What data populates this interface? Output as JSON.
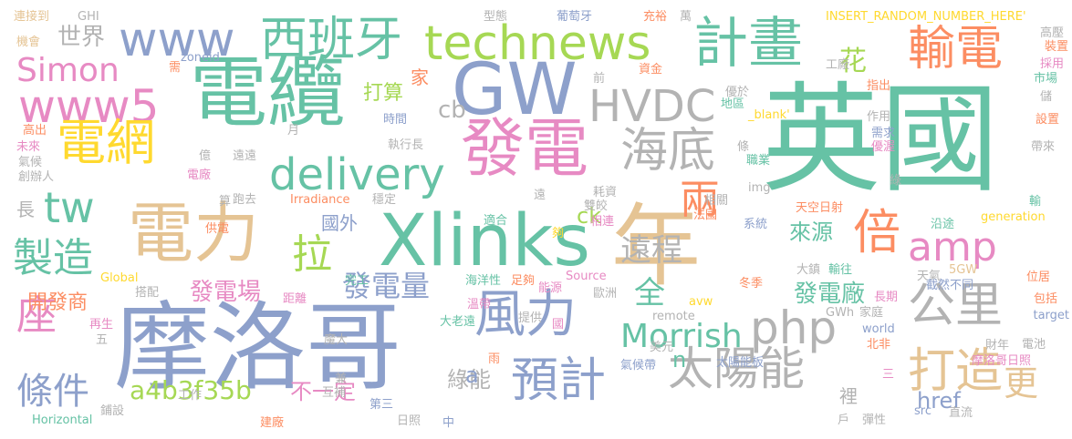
{
  "palette": {
    "green": "#66c2a5",
    "orange": "#fc8d62",
    "blue": "#8da0cb",
    "pink": "#e78ac3",
    "lime": "#a6d854",
    "yellow": "#ffd92f",
    "tan": "#e5c494",
    "gray": "#b3b3b3"
  },
  "words": [
    {
      "text": "英國",
      "color": "#66c2a5"
    },
    {
      "text": "摩洛哥",
      "color": "#8da0cb"
    },
    {
      "text": "電纜",
      "color": "#66c2a5"
    },
    {
      "text": "GW",
      "color": "#8da0cb"
    },
    {
      "text": "Xlinks",
      "color": "#66c2a5"
    },
    {
      "text": "年",
      "color": "#e5c494"
    },
    {
      "text": "電力",
      "color": "#e5c494"
    },
    {
      "text": "發電",
      "color": "#e78ac3"
    },
    {
      "text": "technews",
      "color": "#a6d854"
    },
    {
      "text": "計畫",
      "color": "#66c2a5"
    },
    {
      "text": "西班牙",
      "color": "#66c2a5"
    },
    {
      "text": "www",
      "color": "#8da0cb"
    },
    {
      "text": "www5",
      "color": "#e78ac3"
    },
    {
      "text": "Simon",
      "color": "#e78ac3"
    },
    {
      "text": "電網",
      "color": "#ffd92f"
    },
    {
      "text": "delivery",
      "color": "#66c2a5"
    },
    {
      "text": "HVDC",
      "color": "#b3b3b3"
    },
    {
      "text": "海底",
      "color": "#b3b3b3"
    },
    {
      "text": "輸電",
      "color": "#fc8d62"
    },
    {
      "text": "倍",
      "color": "#fc8d62"
    },
    {
      "text": "風力",
      "color": "#8da0cb"
    },
    {
      "text": "php",
      "color": "#b3b3b3"
    },
    {
      "text": "公里",
      "color": "#b3b3b3"
    },
    {
      "text": "預計",
      "color": "#8da0cb"
    },
    {
      "text": "太陽能",
      "color": "#b3b3b3"
    },
    {
      "text": "打造",
      "color": "#e5c494"
    },
    {
      "text": "amp",
      "color": "#e78ac3"
    },
    {
      "text": "製造",
      "color": "#66c2a5"
    },
    {
      "text": "tw",
      "color": "#66c2a5"
    },
    {
      "text": "座",
      "color": "#e78ac3"
    },
    {
      "text": "條件",
      "color": "#8da0cb"
    },
    {
      "text": "拉",
      "color": "#a6d854"
    },
    {
      "text": "Morrish",
      "color": "#66c2a5"
    },
    {
      "text": "兩",
      "color": "#fc8d62"
    },
    {
      "text": "遠程",
      "color": "#b3b3b3"
    },
    {
      "text": "全",
      "color": "#66c2a5"
    },
    {
      "text": "更",
      "color": "#e5c494"
    },
    {
      "text": "發電量",
      "color": "#8da0cb"
    },
    {
      "text": "a4b3f35b",
      "color": "#a6d854"
    },
    {
      "text": "花",
      "color": "#a6d854"
    },
    {
      "text": "世界",
      "color": "#b3b3b3"
    },
    {
      "text": "發電場",
      "color": "#e78ac3"
    },
    {
      "text": "開發商",
      "color": "#fc8d62"
    },
    {
      "text": "發電廠",
      "color": "#66c2a5"
    },
    {
      "text": "來源",
      "color": "#66c2a5"
    },
    {
      "text": "打算",
      "color": "#a6d854"
    },
    {
      "text": "國外",
      "color": "#8da0cb"
    },
    {
      "text": "綠能",
      "color": "#b3b3b3"
    },
    {
      "text": "不一定",
      "color": "#e78ac3"
    },
    {
      "text": "href",
      "color": "#8da0cb"
    },
    {
      "text": "cb",
      "color": "#b3b3b3"
    },
    {
      "text": "ck",
      "color": "#a6d854"
    },
    {
      "text": "長",
      "color": "#b3b3b3"
    },
    {
      "text": "家",
      "color": "#fc8d62"
    },
    {
      "text": "a",
      "color": "#8da0cb"
    },
    {
      "text": "n",
      "color": "#66c2a5"
    },
    {
      "text": "裡",
      "color": "#b3b3b3"
    },
    {
      "text": "INSERT_RANDOM_NUMBER_HERE'",
      "color": "#ffd92f"
    },
    {
      "text": "連接到",
      "color": "#e5c494"
    },
    {
      "text": "機會",
      "color": "#e5c494"
    },
    {
      "text": "GHI",
      "color": "#b3b3b3"
    },
    {
      "text": "zoneid",
      "color": "#8da0cb"
    },
    {
      "text": "型態",
      "color": "#b3b3b3"
    },
    {
      "text": "葡萄牙",
      "color": "#8da0cb"
    },
    {
      "text": "充裕",
      "color": "#fc8d62"
    },
    {
      "text": "萬",
      "color": "#b3b3b3"
    },
    {
      "text": "高壓",
      "color": "#b3b3b3"
    },
    {
      "text": "裝置",
      "color": "#fc8d62"
    },
    {
      "text": "市場",
      "color": "#66c2a5"
    },
    {
      "text": "採用",
      "color": "#e78ac3"
    },
    {
      "text": "工廠",
      "color": "#b3b3b3"
    },
    {
      "text": "資金",
      "color": "#fc8d62"
    },
    {
      "text": "前",
      "color": "#b3b3b3"
    },
    {
      "text": "指出",
      "color": "#fc8d62"
    },
    {
      "text": "儲",
      "color": "#b3b3b3"
    },
    {
      "text": "設置",
      "color": "#fc8d62"
    },
    {
      "text": "優於",
      "color": "#b3b3b3"
    },
    {
      "text": "地區",
      "color": "#66c2a5"
    },
    {
      "text": "_blank'",
      "color": "#ffd92f"
    },
    {
      "text": "作用",
      "color": "#b3b3b3"
    },
    {
      "text": "需求",
      "color": "#8da0cb"
    },
    {
      "text": "優渥",
      "color": "#e78ac3"
    },
    {
      "text": "帶來",
      "color": "#b3b3b3"
    },
    {
      "text": "條",
      "color": "#b3b3b3"
    },
    {
      "text": "職業",
      "color": "#66c2a5"
    },
    {
      "text": "高出",
      "color": "#fc8d62"
    },
    {
      "text": "未來",
      "color": "#e78ac3"
    },
    {
      "text": "氣候",
      "color": "#b3b3b3"
    },
    {
      "text": "創辦人",
      "color": "#b3b3b3"
    },
    {
      "text": "時間",
      "color": "#8da0cb"
    },
    {
      "text": "執行長",
      "color": "#b3b3b3"
    },
    {
      "text": "月",
      "color": "#b3b3b3"
    },
    {
      "text": "億",
      "color": "#b3b3b3"
    },
    {
      "text": "遠遠",
      "color": "#b3b3b3"
    },
    {
      "text": "電廠",
      "color": "#e78ac3"
    },
    {
      "text": "算",
      "color": "#b3b3b3"
    },
    {
      "text": "跑去",
      "color": "#b3b3b3"
    },
    {
      "text": "Irradiance",
      "color": "#fc8d62"
    },
    {
      "text": "穩定",
      "color": "#b3b3b3"
    },
    {
      "text": "遠",
      "color": "#b3b3b3"
    },
    {
      "text": "耗資",
      "color": "#b3b3b3"
    },
    {
      "text": "雙皎",
      "color": "#b3b3b3"
    },
    {
      "text": "img",
      "color": "#b3b3b3"
    },
    {
      "text": "相關",
      "color": "#b3b3b3"
    },
    {
      "text": "天空日射",
      "color": "#fc8d62"
    },
    {
      "text": "綠",
      "color": "#b3b3b3"
    },
    {
      "text": "輸",
      "color": "#66c2a5"
    },
    {
      "text": "供電",
      "color": "#fc8d62"
    },
    {
      "text": "適合",
      "color": "#66c2a5"
    },
    {
      "text": "夠",
      "color": "#ffd92f"
    },
    {
      "text": "相連",
      "color": "#e78ac3"
    },
    {
      "text": "法國",
      "color": "#fc8d62"
    },
    {
      "text": "系統",
      "color": "#8da0cb"
    },
    {
      "text": "沿途",
      "color": "#66c2a5"
    },
    {
      "text": "generation",
      "color": "#ffd92f"
    },
    {
      "text": "大鎮",
      "color": "#b3b3b3"
    },
    {
      "text": "輸往",
      "color": "#66c2a5"
    },
    {
      "text": "5GW",
      "color": "#e5c494"
    },
    {
      "text": "天氣",
      "color": "#b3b3b3"
    },
    {
      "text": "截然不同",
      "color": "#8da0cb"
    },
    {
      "text": "位居",
      "color": "#fc8d62"
    },
    {
      "text": "長期",
      "color": "#e78ac3"
    },
    {
      "text": "冬季",
      "color": "#fc8d62"
    },
    {
      "text": "Global",
      "color": "#ffd92f"
    },
    {
      "text": "完工",
      "color": "#66c2a5"
    },
    {
      "text": "搭配",
      "color": "#b3b3b3"
    },
    {
      "text": "距離",
      "color": "#e78ac3"
    },
    {
      "text": "海洋性",
      "color": "#66c2a5"
    },
    {
      "text": "足夠",
      "color": "#fc8d62"
    },
    {
      "text": "能源",
      "color": "#e78ac3"
    },
    {
      "text": "Source",
      "color": "#e78ac3"
    },
    {
      "text": "歐洲",
      "color": "#b3b3b3"
    },
    {
      "text": "avw",
      "color": "#ffd92f"
    },
    {
      "text": "包括",
      "color": "#fc8d62"
    },
    {
      "text": "溫帶",
      "color": "#e78ac3"
    },
    {
      "text": "提供",
      "color": "#b3b3b3"
    },
    {
      "text": "remote",
      "color": "#b3b3b3"
    },
    {
      "text": "GWh",
      "color": "#b3b3b3"
    },
    {
      "text": "家庭",
      "color": "#b3b3b3"
    },
    {
      "text": "target",
      "color": "#8da0cb"
    },
    {
      "text": "再生",
      "color": "#e78ac3"
    },
    {
      "text": "五",
      "color": "#b3b3b3"
    },
    {
      "text": "大老遠",
      "color": "#66c2a5"
    },
    {
      "text": "國",
      "color": "#e78ac3"
    },
    {
      "text": "world",
      "color": "#8da0cb"
    },
    {
      "text": "北非",
      "color": "#fc8d62"
    },
    {
      "text": "魔大",
      "color": "#b3b3b3"
    },
    {
      "text": "美元",
      "color": "#b3b3b3"
    },
    {
      "text": "財年",
      "color": "#b3b3b3"
    },
    {
      "text": "電池",
      "color": "#b3b3b3"
    },
    {
      "text": "雨",
      "color": "#fc8d62"
    },
    {
      "text": "氣候帶",
      "color": "#8da0cb"
    },
    {
      "text": "太陽能板",
      "color": "#8da0cb"
    },
    {
      "text": "摩洛哥日照",
      "color": "#e78ac3"
    },
    {
      "text": "三",
      "color": "#e78ac3"
    },
    {
      "text": "兼",
      "color": "#b3b3b3"
    },
    {
      "text": "互補",
      "color": "#b3b3b3"
    },
    {
      "text": "工作",
      "color": "#b3b3b3"
    },
    {
      "text": "第三",
      "color": "#8da0cb"
    },
    {
      "text": "鋪設",
      "color": "#b3b3b3"
    },
    {
      "text": "Horizontal",
      "color": "#66c2a5"
    },
    {
      "text": "建廠",
      "color": "#fc8d62"
    },
    {
      "text": "日照",
      "color": "#b3b3b3"
    },
    {
      "text": "中",
      "color": "#8da0cb"
    },
    {
      "text": "戶",
      "color": "#b3b3b3"
    },
    {
      "text": "彈性",
      "color": "#b3b3b3"
    },
    {
      "text": "src",
      "color": "#8da0cb"
    },
    {
      "text": "直流",
      "color": "#b3b3b3"
    },
    {
      "text": "需",
      "color": "#fc8d62"
    }
  ]
}
